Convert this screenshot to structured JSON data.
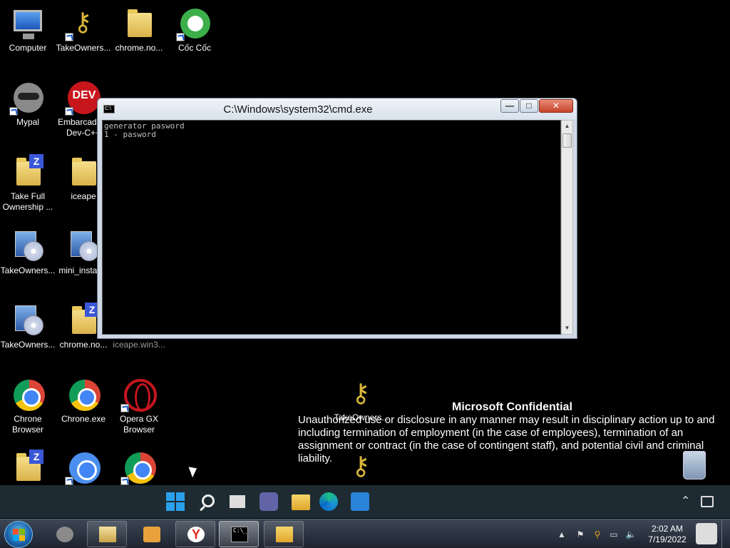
{
  "desktop_icons": [
    {
      "label": "Computer",
      "icon": "computer-icon"
    },
    {
      "label": "TakeOwners...",
      "icon": "keys-icon"
    },
    {
      "label": "chrome.no...",
      "icon": "folder-icon"
    },
    {
      "label": "Cốc Cốc",
      "icon": "coccoc-icon"
    },
    {
      "label": "Mypal",
      "icon": "mypal-icon"
    },
    {
      "label": "Embarcadero Dev-C++",
      "icon": "devcpp-icon"
    },
    {
      "label": "Take Full Ownership ...",
      "icon": "zip-folder-icon"
    },
    {
      "label": "iceape",
      "icon": "folder-icon"
    },
    {
      "label": "TakeOwners...",
      "icon": "setup-icon"
    },
    {
      "label": "mini_install...",
      "icon": "setup-icon"
    },
    {
      "label": "TakeOwners...",
      "icon": "setup-icon"
    },
    {
      "label": "chrome.no...",
      "icon": "zip-folder-icon"
    },
    {
      "label": "iceape.win3...",
      "icon": "folder-icon"
    },
    {
      "label": "Chrone Browser",
      "icon": "chrome-icon"
    },
    {
      "label": "Chrone.exe",
      "icon": "chrome-icon"
    },
    {
      "label": "Opera GX Browser",
      "icon": "opera-icon"
    },
    {
      "label": "TakeOwners...",
      "icon": "keys-icon"
    }
  ],
  "cmd_window": {
    "title": "C:\\Windows\\system32\\cmd.exe",
    "icon_text": "C:\\",
    "lines": [
      "generator pasword",
      "1 - pasword"
    ],
    "buttons": {
      "minimize": "—",
      "maximize": "□",
      "close": "✕"
    }
  },
  "notice": {
    "title": "Microsoft Confidential",
    "body": "Unauthorized use or disclosure in any manner may result in disciplinary action up to and including termination of employment (in the case of employees), termination of an assignment or contract (in the case of contingent staff), and potential civil and criminal liability."
  },
  "taskbar": {
    "cmd_text": "C:\\_",
    "yandex_text": "Y",
    "time": "2:02 AM",
    "date": "7/19/2022"
  },
  "colors": {
    "desktop": "#000000",
    "console_bg": "#000000",
    "console_fg": "#c0c0c0",
    "close_button": "#c7432a",
    "win11_bar": "#1e2b33",
    "taskbar": "#1d2430"
  }
}
